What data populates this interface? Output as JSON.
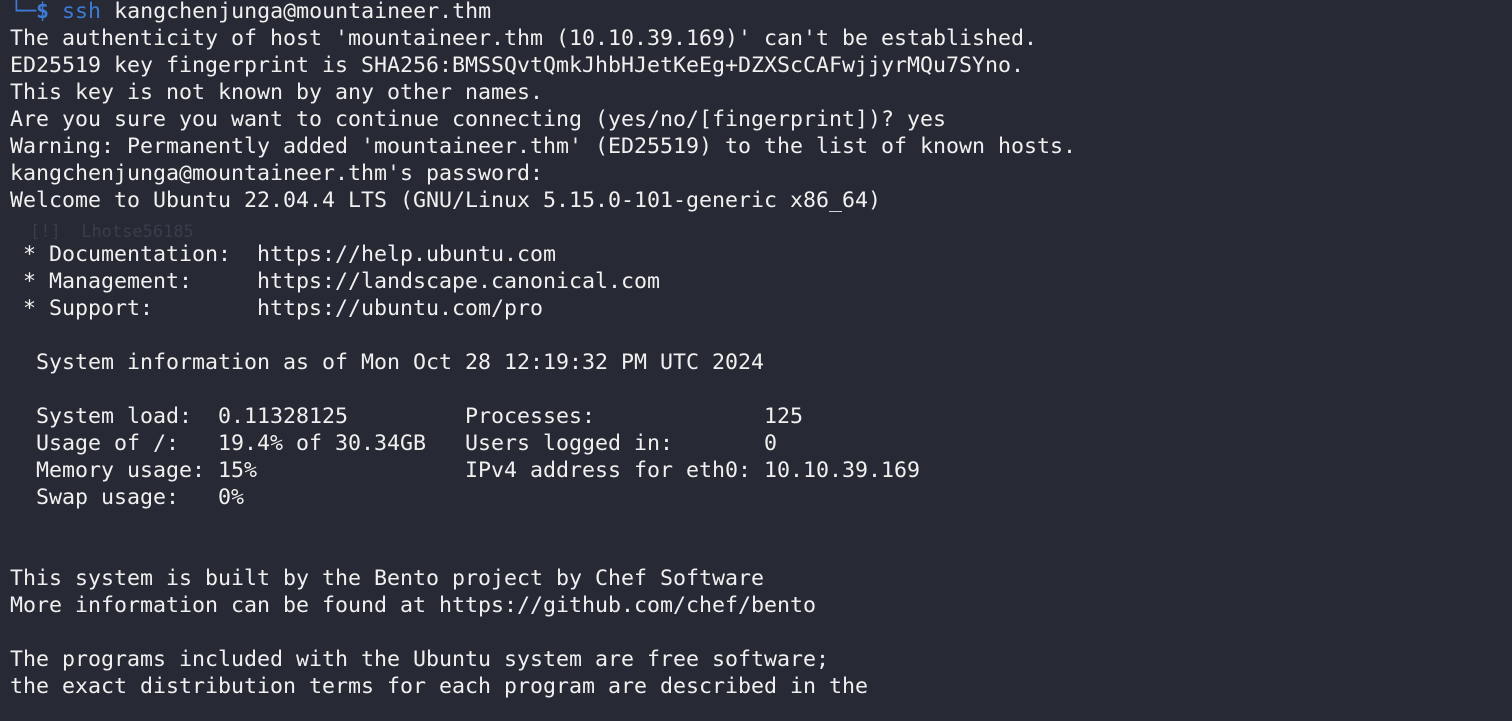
{
  "prompt": {
    "corner": "└─",
    "symbol": "$",
    "command": "ssh",
    "argument": "kangchenjunga@mountaineer.thm"
  },
  "ghost": {
    "password": "Lhotse56185"
  },
  "lines": {
    "l1": "The authenticity of host 'mountaineer.thm (10.10.39.169)' can't be established.",
    "l2": "ED25519 key fingerprint is SHA256:BMSSQvtQmkJhbHJetKeEg+DZXScCAFwjjyrMQu7SYno.",
    "l3": "This key is not known by any other names.",
    "l4": "Are you sure you want to continue connecting (yes/no/[fingerprint])? yes",
    "l5": "Warning: Permanently added 'mountaineer.thm' (ED25519) to the list of known hosts.",
    "l6": "kangchenjunga@mountaineer.thm's password:",
    "l7": "Welcome to Ubuntu 22.04.4 LTS (GNU/Linux 5.15.0-101-generic x86_64)",
    "l9": " * Documentation:  https://help.ubuntu.com",
    "l10": " * Management:     https://landscape.canonical.com",
    "l11": " * Support:        https://ubuntu.com/pro",
    "l13": "  System information as of Mon Oct 28 12:19:32 PM UTC 2024",
    "l15": "  System load:  0.11328125         Processes:             125",
    "l16": "  Usage of /:   19.4% of 30.34GB   Users logged in:       0",
    "l17": "  Memory usage: 15%                IPv4 address for eth0: 10.10.39.169",
    "l18": "  Swap usage:   0%",
    "l21": "This system is built by the Bento project by Chef Software",
    "l22": "More information can be found at https://github.com/chef/bento",
    "l24": "The programs included with the Ubuntu system are free software;",
    "l25": "the exact distribution terms for each program are described in the"
  }
}
